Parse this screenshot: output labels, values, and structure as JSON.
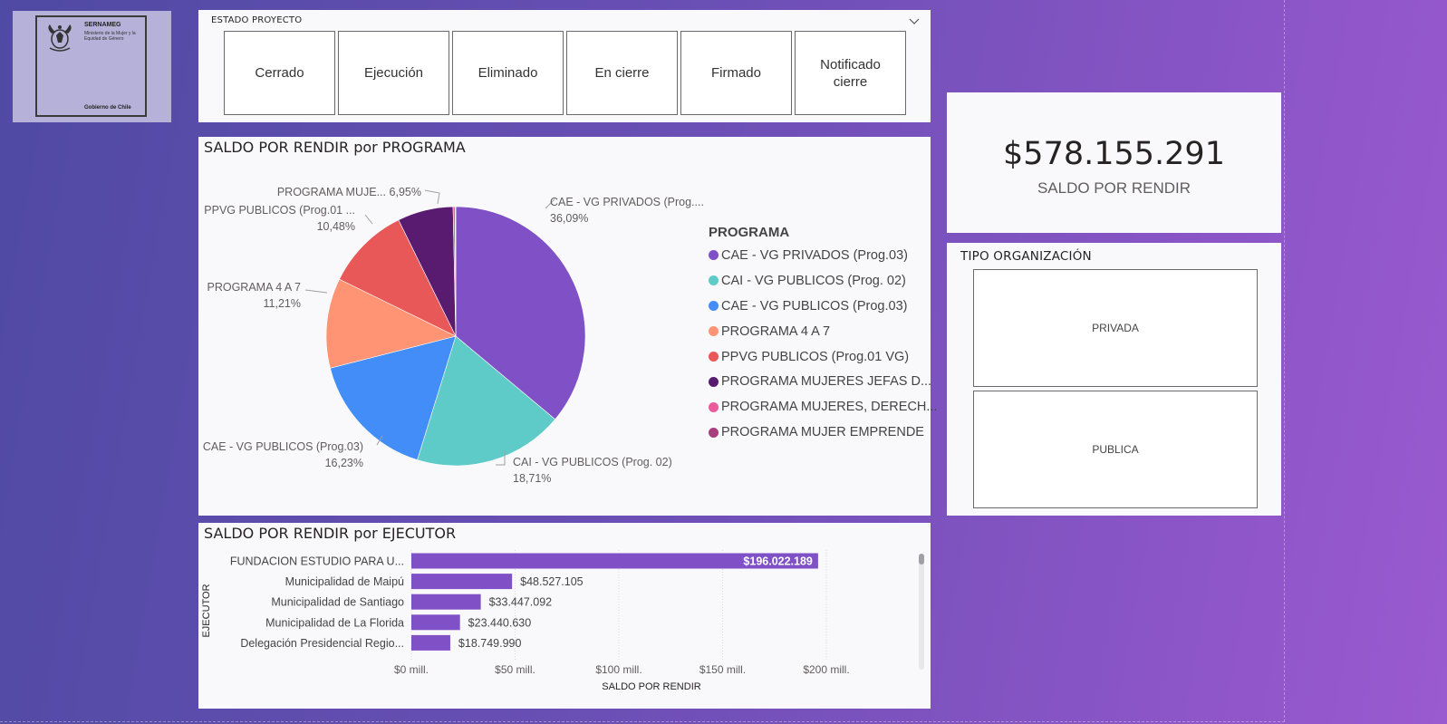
{
  "logo": {
    "org": "SERNAMEG",
    "subtitle": "Ministerio de la Mujer y la Equidad de Género",
    "footer": "Gobierno de Chile"
  },
  "estado_proyecto": {
    "title": "ESTADO PROYECTO",
    "options": [
      "Cerrado",
      "Ejecución",
      "Eliminado",
      "En cierre",
      "Firmado",
      "Notificado cierre"
    ]
  },
  "pie": {
    "title": "SALDO POR RENDIR por PROGRAMA",
    "legend_title": "PROGRAMA",
    "legend": [
      {
        "label": "CAE - VG PRIVADOS  (Prog.03)",
        "color": "#7f50c6"
      },
      {
        "label": "CAI - VG PUBLICOS (Prog. 02)",
        "color": "#5ecbc8"
      },
      {
        "label": "CAE - VG PUBLICOS (Prog.03)",
        "color": "#428df7"
      },
      {
        "label": "PROGRAMA 4 A 7",
        "color": "#fe9474"
      },
      {
        "label": "PPVG PUBLICOS  (Prog.01 VG)",
        "color": "#e95859"
      },
      {
        "label": "PROGRAMA MUJERES JEFAS D...",
        "color": "#581b6f"
      },
      {
        "label": "PROGRAMA MUJERES, DERECH...",
        "color": "#ea5b9e"
      },
      {
        "label": "PROGRAMA MUJER EMPRENDE",
        "color": "#a83e7e"
      }
    ],
    "labels": [
      {
        "name": "CAE - VG PRIVADOS (Prog....",
        "pct": "36,09%"
      },
      {
        "name": "CAI - VG PUBLICOS (Prog. 02)",
        "pct": "18,71%"
      },
      {
        "name": "CAE - VG PUBLICOS (Prog.03)",
        "pct": "16,23%"
      },
      {
        "name": "PROGRAMA 4 A 7",
        "pct": "11,21%"
      },
      {
        "name": "PPVG PUBLICOS (Prog.01 ...",
        "pct": "10,48%"
      },
      {
        "name": "PROGRAMA MUJE...",
        "pct": "6,95%"
      }
    ]
  },
  "kpi": {
    "value": "$578.155.291",
    "label": "SALDO POR RENDIR"
  },
  "tipo_organizacion": {
    "title": "TIPO ORGANIZACIÓN",
    "options": [
      "PRIVADA",
      "PUBLICA"
    ]
  },
  "bar": {
    "title": "SALDO POR RENDIR por EJECUTOR",
    "bar_color": "#7f50c6"
  },
  "chart_data": [
    {
      "type": "pie",
      "title": "SALDO POR RENDIR por PROGRAMA",
      "legend_title": "PROGRAMA",
      "legend_position": "right",
      "categories": [
        "CAE - VG PRIVADOS  (Prog.03)",
        "CAI - VG PUBLICOS (Prog. 02)",
        "CAE - VG PUBLICOS (Prog.03)",
        "PROGRAMA 4 A 7",
        "PPVG PUBLICOS  (Prog.01 VG)",
        "PROGRAMA MUJERES JEFAS D...",
        "PROGRAMA MUJERES, DERECH...",
        "PROGRAMA MUJER EMPRENDE"
      ],
      "values": [
        36.09,
        18.71,
        16.23,
        11.21,
        10.48,
        6.95,
        0.25,
        0.08
      ],
      "colors": [
        "#7f50c6",
        "#5ecbc8",
        "#428df7",
        "#fe9474",
        "#e95859",
        "#581b6f",
        "#ea5b9e",
        "#a83e7e"
      ]
    },
    {
      "type": "bar",
      "orientation": "horizontal",
      "title": "SALDO POR RENDIR por EJECUTOR",
      "xlabel": "SALDO POR RENDIR",
      "ylabel": "EJECUTOR",
      "categories": [
        "FUNDACION ESTUDIO PARA U...",
        "Municipalidad de Maipú",
        "Municipalidad de Santiago",
        "Municipalidad de La Florida",
        "Delegación Presidencial Regio..."
      ],
      "values": [
        196022189,
        48527105,
        33447092,
        23440630,
        18749990
      ],
      "data_labels": [
        "$196.022.189",
        "$48.527.105",
        "$33.447.092",
        "$23.440.630",
        "$18.749.990"
      ],
      "xticks": [
        0,
        50000000,
        100000000,
        150000000,
        200000000
      ],
      "xtick_labels": [
        "$0 mill.",
        "$50 mill.",
        "$100 mill.",
        "$150 mill.",
        "$200 mill."
      ],
      "xlim": [
        0,
        230000000
      ],
      "grid": true
    }
  ]
}
